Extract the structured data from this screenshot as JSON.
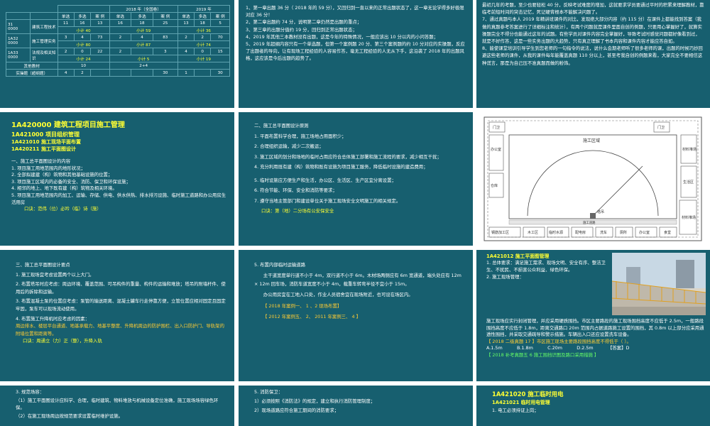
{
  "s1": {
    "hdr": [
      "单选",
      "多选",
      "案 例",
      "单选",
      "多选",
      "案 例",
      "单选",
      "多选",
      "案 例"
    ],
    "yr_labels": [
      "2018 年（全国卷）",
      "2019 年"
    ],
    "nums0": [
      "11",
      "16",
      "13",
      "16",
      "18",
      "25",
      "13",
      "18",
      "5"
    ],
    "rows": [
      {
        "code": "31\n0000",
        "name": "建筑工程技术",
        "vals": [
          "",
          "",
          "",
          "",
          "",
          "",
          "",
          "",
          ""
        ],
        "sub": [
          "小计 40",
          "小计 59",
          "小计 36"
        ]
      },
      {
        "code": "1A32\n0000",
        "name": "施工管理实务",
        "vals": [
          "3",
          "4",
          "73",
          "2",
          "4",
          "83",
          "2",
          "2",
          "70"
        ],
        "sub": [
          "小计 80",
          "小计 87",
          "小计 74"
        ]
      },
      {
        "code": "1A33\n0000",
        "name": "法规及相关知识",
        "vals": [
          "2",
          "0",
          "22",
          "2",
          "",
          "3",
          "4",
          "0",
          "15"
        ],
        "sub": [
          "小计 24",
          "小计 5",
          "小计 19"
        ]
      }
    ],
    "other_label": "其他教材",
    "other_vals": [
      "10",
      "2+4"
    ],
    "total_label": "实操题（超纲题）",
    "total_vals": [
      "4",
      "2",
      "30",
      "1",
      "30"
    ]
  },
  "s2": {
    "l1": "1、第一章出题 36 分（ 2018 年的 59 分），又回归到一直以来的正常出题状态了，这一章无论学得多好极限对应 36 分！",
    "l2": "2、第二章出题约 74 分，说明第二章仍然是出题的重点；",
    "l3": "3、第三章的出题分值约 19 分，回归到正常出题状态；",
    "l4": "4、2019 年其他三本教材没有出题，这是今年的特殊情况，一般应该出 10 分以内的小问答题；",
    "l5": "5、2019 年超纲内容只有一个单选题，但第一个案例题 20 分、第三个案例题的约 10 分对应的实操题，反应了出题者的导向，让有现场工程经验的人容易作答，毫无工程经验的人无从下手，这沿袭了 2018 年的出题风格，这应该是今后出题的趋势了。"
  },
  "s3": {
    "l1": "最初几年的考题，至少也要轻松 40 分，反映考试难度的增加，这就要求学员要通过平时的积累来理解教材，靠临考前短时间的突击记忆，死记硬背根本不能解决问题了。",
    "l2": "7、通过真题与本人 2019 年精讲班课件的对比，发现绝大部分内容（约 115 分）在课件上都能找到答案（我做的真题参考答案进行了详细标注和统计），有两个问题就是课件里面自创的例题，只要用心掌握好了，就算实操题完全不得分也能通过这年的试题。有些学员对课件内容完全掌握好，导致考试时感觉问题都好像看到过，就是不好作答，这是一些实务出题的大趋势，只有真正理解了书本内容和课件内容才能应答自如。",
    "l3": "8、能使课堂培训引导学生到您老师的一句指令的说法，说什么会期老师听了很多老师的课，出题的时候巧妙回避这些老师的课件，从我的课件每年能覆盖真题 110 分以上，甚至考我自创的例题来看，大家完全不要相信这种谎言，那是为自己压不准真题而做的粉饰。"
  },
  "s4": {
    "h1": "1A420000  建筑工程项目施工管理",
    "h2": "1A421000  项目组织管理",
    "h3": "1A421010 施工现场平面布置",
    "h4": "1A420211  施工平面图设计",
    "t0": "一、施工总平面图设计的内容",
    "t1": "1. 项目施工用地范围内的地形状况；",
    "t2": "2. 全部拟建建（构）筑物和其他基础设施的位置；",
    "t3": "3. 项目施工区域内的必备的安全、消防、保卫和环保设施；",
    "t4": "4. 相邻的地上、地下既有建（构）筑物及相关环境。",
    "t5": "5. 项目施工用地范围内的加工、运输、存储、供电、供水供热、排水排污设施、临时施工道路和办公用房生活用房",
    "mn": "口诀：范伟（位）必吟（临）诗（施）"
  },
  "s5": {
    "t0": "二、施工总平面图设计原则",
    "t1": "1. 平面布置科学合理，施工场地占用面积少；",
    "t2": "2. 合理组织运输，减少二次搬运；",
    "t3": "3. 施工区域的划分和场地的临时占用应符合总体施工部署和施工流程的要求，减少相互干扰；",
    "t4": "4. 充分利用既有建（构）筑物和既有设施为项目施工服务，降低临时设施的建造费用；",
    "t5": "5. 临时设施应方便生产和生活，办公区、生活区、生产区宜分离设置；",
    "t6": "6. 符合节能、环保、安全和消防等要求；",
    "t7": "7. 遵守当地主管部门和建设单位关于施工现场安全文明施工的相关规定。",
    "mn": "口诀：第（地）二分场有公安保安全"
  },
  "s6": {
    "labels": [
      "门卫",
      "门卫",
      "施工区域",
      "塔吊",
      "施工道路",
      "钢筋加工区",
      "木工区",
      "办公室",
      "仓库",
      "材料堆场",
      "生活区",
      "临时水源",
      "配电房",
      "洗车",
      "厕所",
      "办公室",
      "食堂",
      "材料堆场"
    ]
  },
  "s7": {
    "t0": "三、施工总平面图设计要点",
    "t1": "1. 施工现场宜考虑设置两个以上大门。",
    "t2": "2. 布置塔吊时应考虑：周边环境、覆盖范围、可吊构件的重量、构件的运输和堆放；塔吊的附墙杆件、使用后的拆除和运输。",
    "t3": "3. 布置混凝土泵的位置应考虑：泵管的输送距离、混凝土罐车行走停靠方便，立管位置应相对固定且固定牢固，泵车可以现场流动使用。",
    "t4": "4. 布置施工升降机时应考虑的因素：",
    "t5": "周边排水、楼层平台通道、地基承载力、地基平整度、升降机周边的防护围栏、出入口防护门、导轨架的附墙位置和距离等。",
    "mn": "口诀：周通立（力）正（整），升降入轨"
  },
  "s8": {
    "t0": "5. 布置内部临时运输道路",
    "t1": "主干道宽度单行道不小于 4m，双行道不小于 6m。木材场两侧应有 6m 宽通道，端头处应有 12m × 12m 回车场，消防车道宽度不小于 4m，载重车转弯半径不宜小于 15m。",
    "t2": "办公用房宜在工地入口处，作业人员宿舍宜在现场附近，也可设在场区内。",
    "r1": "【 2018 年案例一、 1 、2 现场布置】",
    "r2": "【 2012 年案例五、 2、 2011 年案例三、 4 】"
  },
  "s9": {
    "h": "1A421012  施工平面图管理",
    "t1": "1. 总体要求：满足施工需求、现场文明、安全有序、整洁卫生、不扰民、不损害公众利益、绿色环保。",
    "t2": "2. 施工现场管理：",
    "t3": "施工现场应实行封闭管理，并应采用硬质围挡。市区主要路段的施工现场围挡高度不应低于 2.5m，一般路段围挡高度不应低于 1.8m，距离交通路口 20m 范围内占据道路施工设置的围挡，其 0.8m 以上部分应采用通透性围挡，并采取交通疏导和警示措施。车辆出入口还应设置洗车设备。",
    "q": "【 2018 二级真题 17 】市区施工现场主要路段围挡高度不得低于（     ）。",
    "opts": "A.1.5m          B.1.8m          C.20m          D.2.5m          【答案】D",
    "ref": "【 2018 补考真题五  6 施工围挡识图及路口采用措施 】"
  },
  "s10": {
    "t0": "3. 规范场容：",
    "t1": "（1）施工平面图设计应科学、合理，临时建筑、物料堆放与机械设备定位准确，施工现场场容绿色环保。",
    "t2": "（2）在施工现场周边按规范要求设置临时维护设施。"
  },
  "s11": {
    "t0": "5. 消防保卫：",
    "t1": "1）必须按照《消防法》的规定，建立和执行消防管理制度；",
    "t2": "2）现场道路应符合施工期间的消防要求；"
  },
  "s12": {
    "h1": "1A421020  施工临时用电",
    "h2": "1A421021  临时用电管理",
    "t1": "1. 电工必须持证上岗；"
  }
}
